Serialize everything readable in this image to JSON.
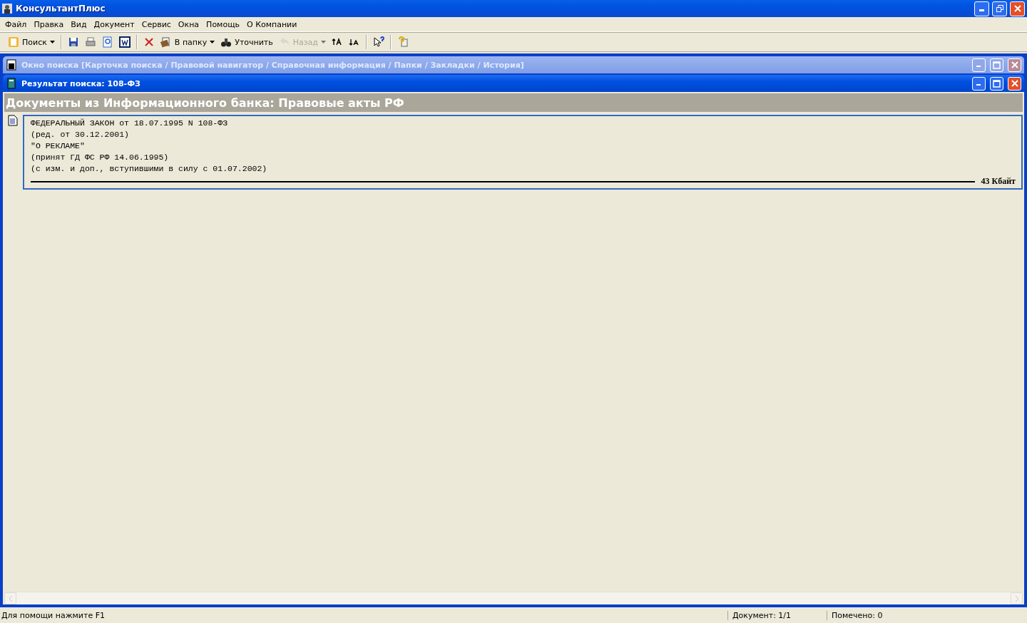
{
  "window": {
    "title": "КонсультантПлюс"
  },
  "menu": [
    "Файл",
    "Правка",
    "Вид",
    "Документ",
    "Сервис",
    "Окна",
    "Помощь",
    "О Компании"
  ],
  "toolbar": [
    {
      "kind": "text",
      "label": "Поиск",
      "dropdown": true,
      "disabled": false
    },
    {
      "kind": "sep"
    },
    {
      "kind": "icon",
      "disabled": false
    },
    {
      "kind": "icon",
      "disabled": false
    },
    {
      "kind": "icon",
      "disabled": false
    },
    {
      "kind": "icon",
      "disabled": false
    },
    {
      "kind": "sep"
    },
    {
      "kind": "icon",
      "disabled": false
    },
    {
      "kind": "text",
      "label": "В папку",
      "dropdown": true,
      "disabled": false
    },
    {
      "kind": "text",
      "label": "Уточнить",
      "dropdown": false,
      "disabled": false
    },
    {
      "kind": "text",
      "label": "Назад",
      "dropdown": true,
      "disabled": true
    },
    {
      "kind": "icon",
      "disabled": false
    },
    {
      "kind": "icon",
      "disabled": false
    },
    {
      "kind": "sep"
    },
    {
      "kind": "icon",
      "disabled": false
    },
    {
      "kind": "sep"
    },
    {
      "kind": "icon",
      "disabled": false
    }
  ],
  "child_windows": [
    {
      "title": "Окно поиска [Карточка поиска / Правовой навигатор / Справочная информация / Папки / Закладки / История]",
      "active": false
    },
    {
      "title": "Результат поиска: 108-ФЗ",
      "active": true
    }
  ],
  "results": {
    "heading": "Документы из Информационного банка: Правовые акты РФ",
    "documents": [
      {
        "lines": [
          "ФЕДЕРАЛЬНЫЙ ЗАКОН от 18.07.1995 N 108-ФЗ",
          "(ред. от 30.12.2001)",
          "\"О РЕКЛАМЕ\"",
          "(принят ГД ФС РФ 14.06.1995)",
          "(с изм. и доп., вступившими в силу с 01.07.2002)"
        ],
        "size": "43 Кбайт",
        "selected": true
      }
    ]
  },
  "status_bar": {
    "hint": "Для помощи нажмите F1",
    "document": "Документ: 1/1",
    "marked": "Помечено: 0"
  }
}
